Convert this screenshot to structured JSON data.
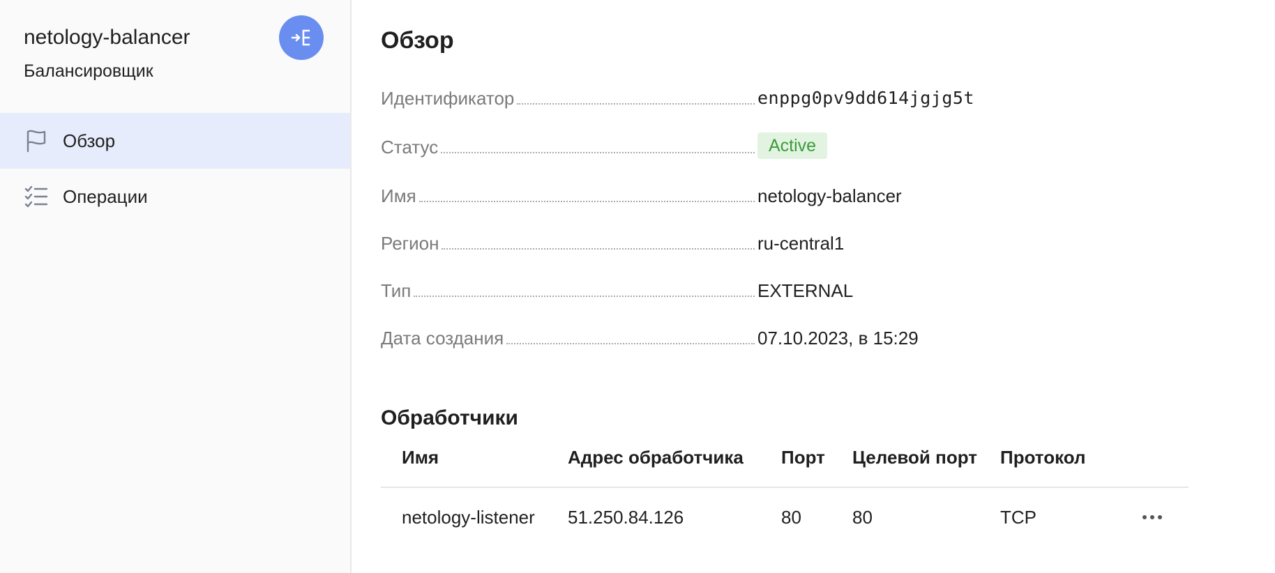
{
  "sidebar": {
    "title": "netology-balancer",
    "subtitle": "Балансировщик",
    "badge_icon": "load-balancer-icon",
    "accent_color": "#6a8ef0",
    "items": [
      {
        "label": "Обзор",
        "icon": "flag-icon",
        "active": true
      },
      {
        "label": "Операции",
        "icon": "checklist-icon",
        "active": false
      }
    ]
  },
  "main": {
    "title": "Обзор",
    "properties": [
      {
        "key": "Идентификатор",
        "value": "enppg0pv9dd614jgjg5t"
      },
      {
        "key": "Статус",
        "value": "Active"
      },
      {
        "key": "Имя",
        "value": "netology-balancer"
      },
      {
        "key": "Регион",
        "value": "ru-central1"
      },
      {
        "key": "Тип",
        "value": "EXTERNAL"
      },
      {
        "key": "Дата создания",
        "value": "07.10.2023, в 15:29"
      }
    ],
    "status_color": "#3a9c3a",
    "status_bg": "#e2f3e1",
    "listeners": {
      "title": "Обработчики",
      "columns": [
        "Имя",
        "Адрес обработчика",
        "Порт",
        "Целевой порт",
        "Протокол"
      ],
      "rows": [
        {
          "name": "netology-listener",
          "address": "51.250.84.126",
          "port": "80",
          "target_port": "80",
          "protocol": "TCP",
          "menu_icon": "more-horizontal-icon"
        }
      ]
    }
  }
}
